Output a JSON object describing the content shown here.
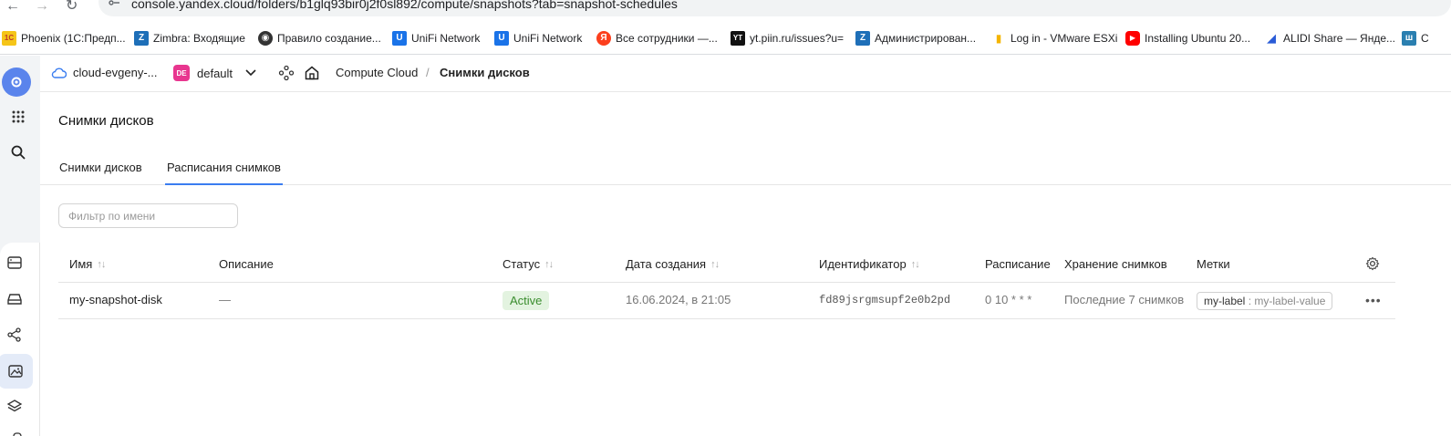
{
  "browser": {
    "url": "console.yandex.cloud/folders/b1glq93bir0j2f0sl892/compute/snapshots?tab=snapshot-schedules",
    "back_icon": "arrow-left-icon",
    "forward_icon": "arrow-right-icon",
    "reload_icon": "reload-icon"
  },
  "bookmarks": [
    {
      "label": "Phoenix (1С:Предп...",
      "icon": "1c-icon",
      "color": "#f5a623",
      "glyph": "1C"
    },
    {
      "label": "Zimbra: Входящие",
      "icon": "zimbra-icon",
      "color": "#1e6fb8",
      "glyph": "Z"
    },
    {
      "label": "Правило создание...",
      "icon": "globe-icon",
      "color": "#333333",
      "glyph": "◉"
    },
    {
      "label": "UniFi Network",
      "icon": "unifi-icon",
      "color": "#1a73e8",
      "glyph": "U"
    },
    {
      "label": "UniFi Network",
      "icon": "unifi-icon",
      "color": "#1a73e8",
      "glyph": "U"
    },
    {
      "label": "Все сотрудники —...",
      "icon": "yandex-icon",
      "color": "#fc3f1d",
      "glyph": "Я"
    },
    {
      "label": "yt.piin.ru/issues?u=",
      "icon": "youtrack-icon",
      "color": "#111111",
      "glyph": "YT"
    },
    {
      "label": "Администрирован...",
      "icon": "zimbra-icon",
      "color": "#1e6fb8",
      "glyph": "Z"
    },
    {
      "label": "Log in - VMware ESXi",
      "icon": "vmware-icon",
      "color": "#f4b400",
      "glyph": "▮"
    },
    {
      "label": "Installing Ubuntu 20...",
      "icon": "youtube-icon",
      "color": "#ff0000",
      "glyph": "▶"
    },
    {
      "label": "ALIDI Share — Яндe...",
      "icon": "yandex-disk-icon",
      "color": "#2a5bd7",
      "glyph": "◢"
    },
    {
      "label": "C",
      "icon": "w-icon",
      "color": "#2a7fb0",
      "glyph": "ш"
    }
  ],
  "header": {
    "cloud_name": "cloud-evgeny-...",
    "folder_badge": "DE",
    "folder_name": "default",
    "service": "Compute Cloud",
    "separator": "/",
    "current": "Снимки дисков"
  },
  "page": {
    "title": "Снимки дисков",
    "tabs": [
      {
        "label": "Снимки дисков",
        "active": false
      },
      {
        "label": "Расписания снимков",
        "active": true
      }
    ],
    "filter_placeholder": "Фильтр по имени"
  },
  "table": {
    "columns": {
      "name": "Имя",
      "description": "Описание",
      "status": "Статус",
      "created": "Дата создания",
      "id": "Идентификатор",
      "schedule": "Расписание",
      "retention": "Хранение снимков",
      "labels": "Метки"
    },
    "sort_glyph": "↑↓",
    "rows": [
      {
        "name": "my-snapshot-disk",
        "description": "—",
        "status": "Active",
        "created": "16.06.2024, в 21:05",
        "id": "fd89jsrgmsupf2e0b2pd",
        "schedule": "0 10 * * *",
        "retention": "Последние 7 снимков",
        "label_key": "my-label",
        "label_sep": " : ",
        "label_value": "my-label-value",
        "menu": "•••"
      }
    ]
  }
}
